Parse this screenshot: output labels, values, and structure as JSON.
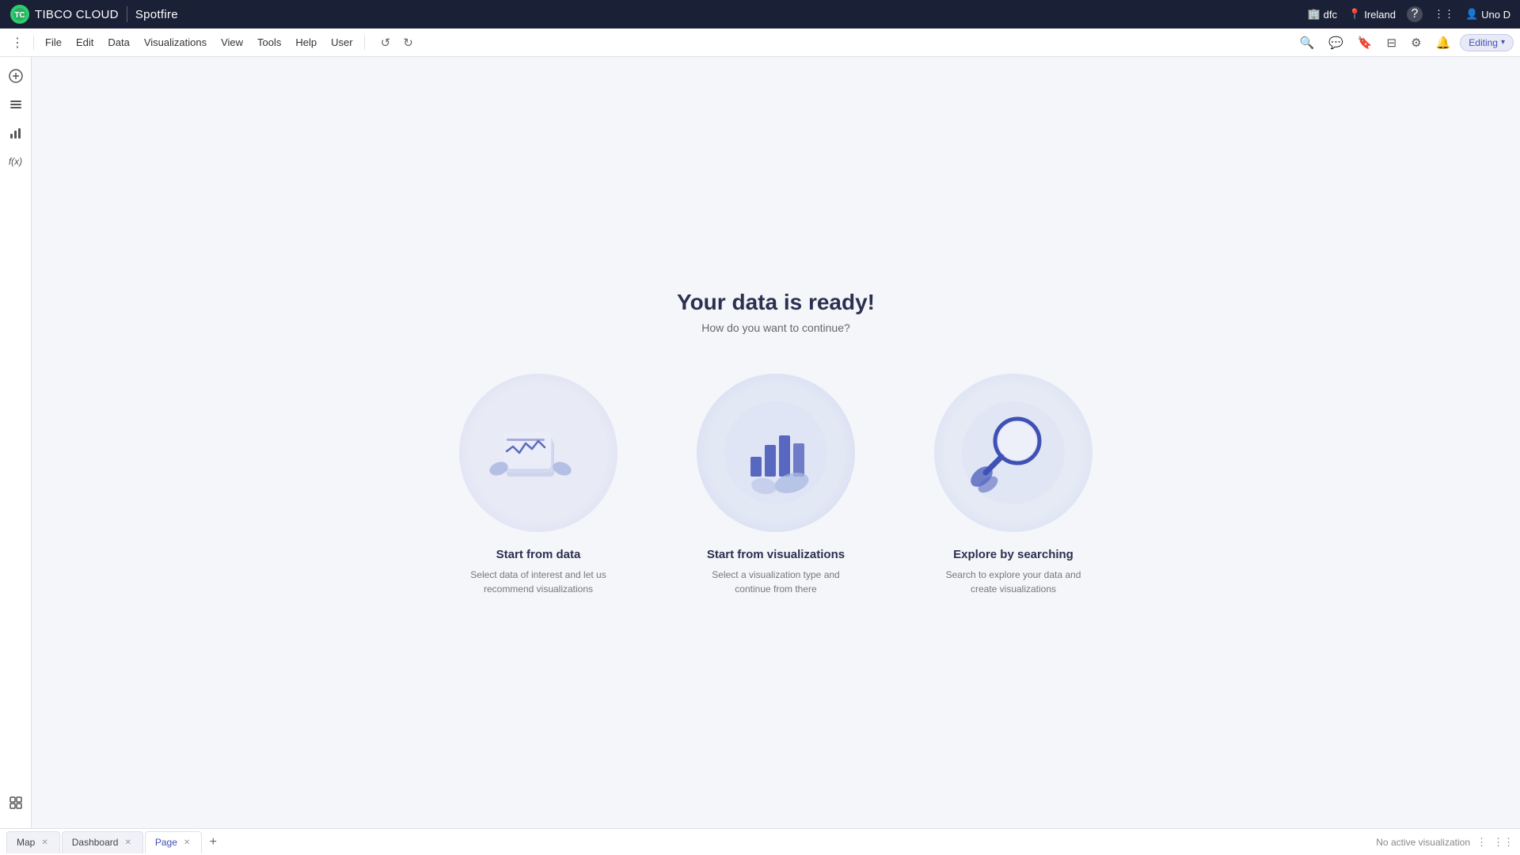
{
  "app": {
    "logo_text": "TIBCO CLOUD",
    "product_name": "Spotfire"
  },
  "topbar": {
    "user_item": "dfc",
    "location": "Ireland",
    "help_label": "?",
    "grid_label": "⋮⋮⋮",
    "user_label": "Uno D"
  },
  "menubar": {
    "file": "File",
    "edit": "Edit",
    "data": "Data",
    "visualizations": "Visualizations",
    "view": "View",
    "tools": "Tools",
    "help": "Help",
    "user": "User",
    "editing_label": "Editing"
  },
  "content": {
    "hero_title": "Your data is ready!",
    "hero_subtitle": "How do you want to continue?",
    "cards": [
      {
        "id": "start-from-data",
        "title": "Start from data",
        "description": "Select data of interest and let us recommend visualizations"
      },
      {
        "id": "start-from-visualizations",
        "title": "Start from visualizations",
        "description": "Select a visualization type and continue from there"
      },
      {
        "id": "explore-by-searching",
        "title": "Explore by searching",
        "description": "Search to explore your data and create visualizations"
      }
    ]
  },
  "tabs": [
    {
      "label": "Map",
      "active": false
    },
    {
      "label": "Dashboard",
      "active": false
    },
    {
      "label": "Page",
      "active": true
    }
  ],
  "statusbar": {
    "status": "No active visualization"
  }
}
